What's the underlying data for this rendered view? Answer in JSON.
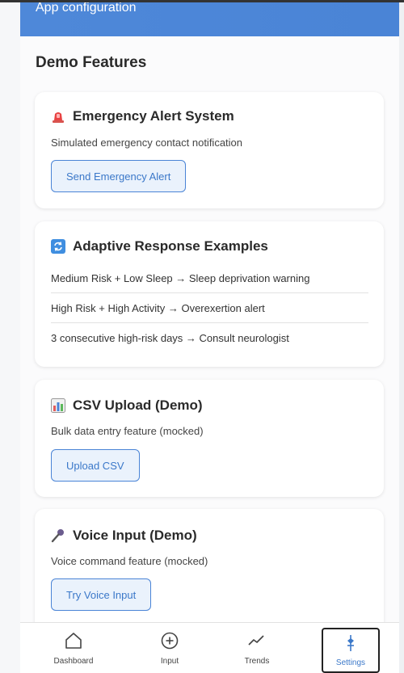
{
  "header": {
    "title": "App configuration"
  },
  "section": {
    "title": "Demo Features"
  },
  "cards": {
    "emergency": {
      "title": "Emergency Alert System",
      "icon": "siren-icon",
      "description": "Simulated emergency contact notification",
      "button": "Send Emergency Alert"
    },
    "adaptive": {
      "title": "Adaptive Response Examples",
      "icon": "refresh-icon",
      "examples": [
        "Medium Risk + Low Sleep → Sleep deprivation warning",
        "High Risk + High Activity → Overexertion alert",
        "3 consecutive high-risk days → Consult neurologist"
      ]
    },
    "csv": {
      "title": "CSV Upload (Demo)",
      "icon": "bar-chart-icon",
      "description": "Bulk data entry feature (mocked)",
      "button": "Upload CSV"
    },
    "voice": {
      "title": "Voice Input (Demo)",
      "icon": "microphone-icon",
      "description": "Voice command feature (mocked)",
      "button": "Try Voice Input"
    }
  },
  "nav": {
    "items": [
      {
        "label": "Dashboard",
        "icon": "home-icon"
      },
      {
        "label": "Input",
        "icon": "plus-circle-icon"
      },
      {
        "label": "Trends",
        "icon": "trend-line-icon"
      },
      {
        "label": "Settings",
        "icon": "settings-pin-icon"
      }
    ],
    "active": "Settings"
  },
  "colors": {
    "accent": "#4a84d6",
    "button_bg": "#eaf2fc",
    "text": "#2a2a2a"
  }
}
